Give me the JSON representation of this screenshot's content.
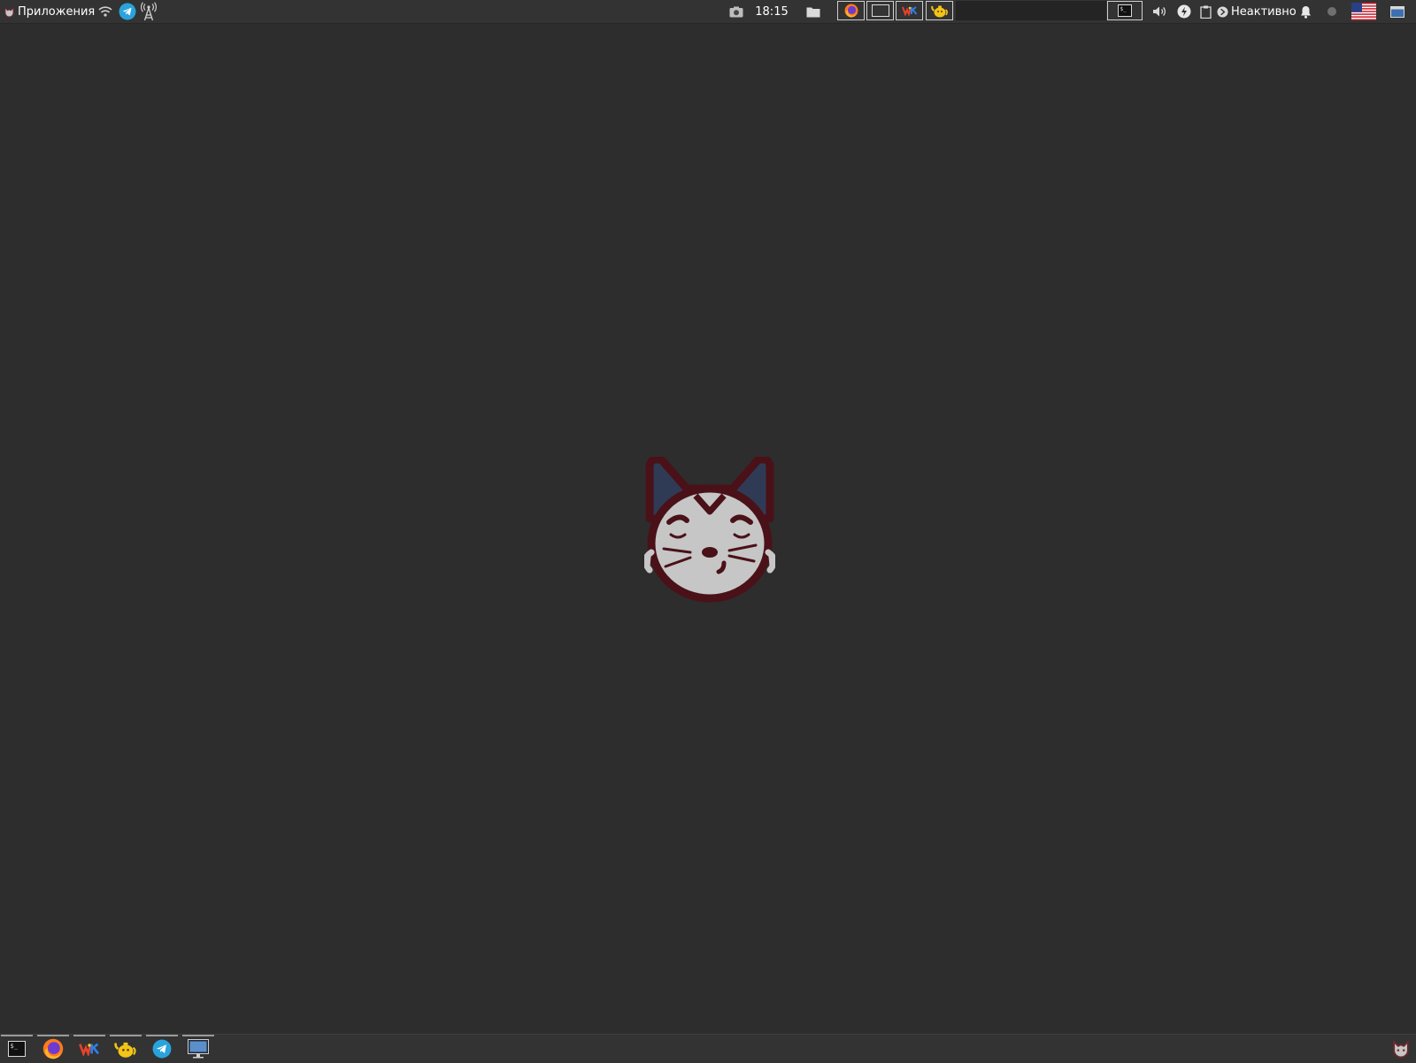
{
  "top_panel": {
    "apps_menu_label": "Приложения",
    "clock": "18:15",
    "idle_status": "Неактивно",
    "keyboard_layout_flag": "us-flag-icon",
    "icons": {
      "apps_menu": "cat-logo-icon",
      "wifi": "wifi-icon",
      "telegram": "telegram-icon",
      "signal": "radio-tower-icon",
      "screenshot": "camera-icon",
      "files": "folder-icon",
      "volume": "speaker-icon",
      "power": "power-bolt-icon",
      "clipboard": "clipboard-icon",
      "caffeine": "caffeine-icon",
      "notifications": "bell-icon",
      "indicator": "dot-icon",
      "show_desktop": "show-desktop-icon"
    },
    "taskbar_windows": [
      {
        "name": "firefox",
        "icon": "firefox-icon"
      },
      {
        "name": "blank-window",
        "icon": "window-icon"
      },
      {
        "name": "multicolor-app",
        "icon": "app-wk-icon"
      },
      {
        "name": "teapot-app",
        "icon": "teapot-icon"
      },
      {
        "name": "terminal",
        "icon": "terminal-icon"
      }
    ]
  },
  "dock": {
    "items": [
      {
        "name": "terminal",
        "icon": "terminal-icon"
      },
      {
        "name": "firefox",
        "icon": "firefox-icon"
      },
      {
        "name": "multicolor-app",
        "icon": "app-wk-icon"
      },
      {
        "name": "teapot-app",
        "icon": "teapot-icon"
      },
      {
        "name": "telegram",
        "icon": "telegram-icon"
      },
      {
        "name": "remote-desktop",
        "icon": "monitor-icon"
      }
    ],
    "corner_icon": "cat-logo-icon"
  },
  "colors": {
    "background": "#2d2d2d",
    "panel": "#333333",
    "logo_outline": "#4a1218",
    "logo_face": "#c6c6c6",
    "logo_ear_inner": "#2f3a55",
    "telegram": "#2aa3dd",
    "firefox": "#ff7a1a"
  }
}
